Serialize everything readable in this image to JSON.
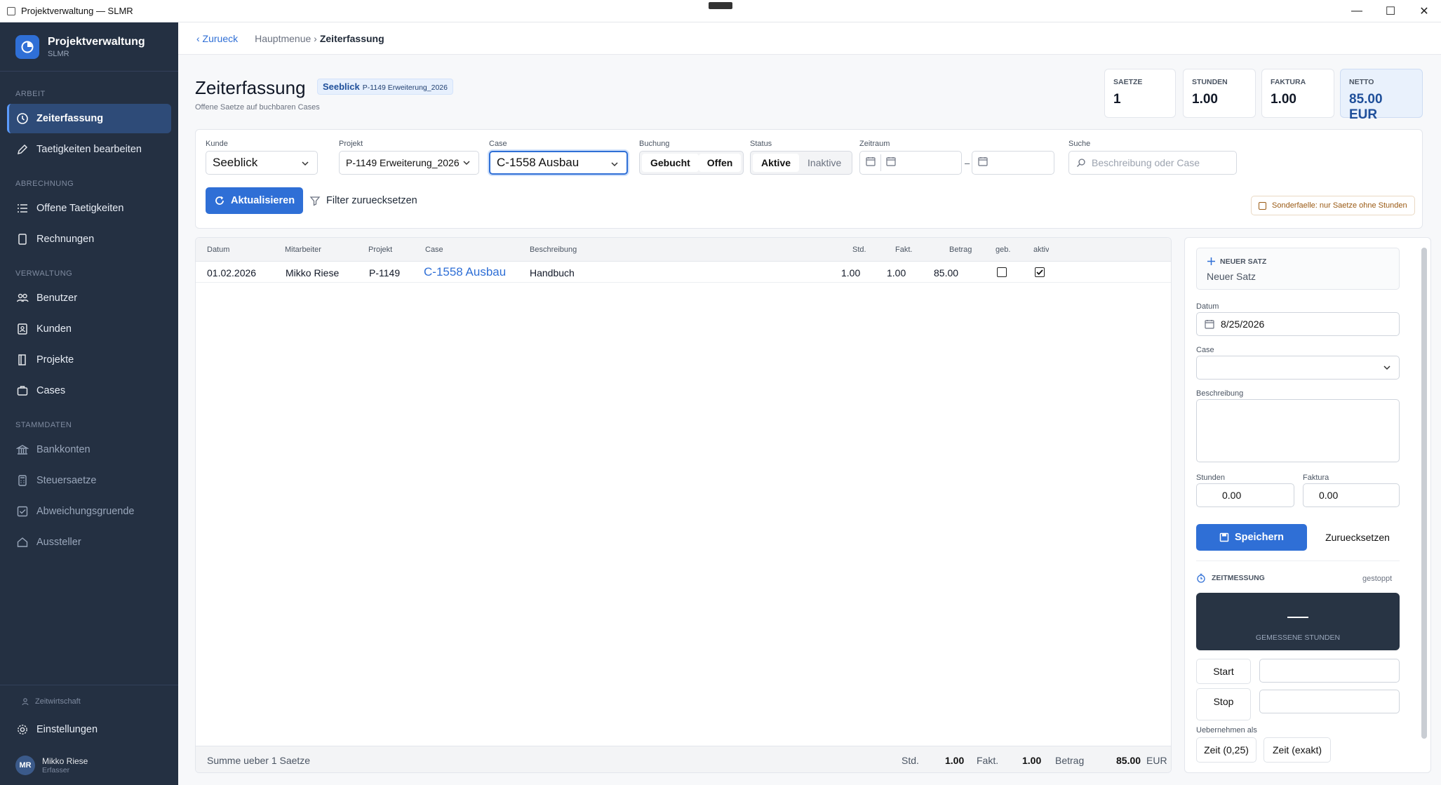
{
  "window": {
    "title": "Projektverwaltung — SLMR",
    "minimize": "—",
    "maximize": "☐",
    "close": "✕"
  },
  "sidebar": {
    "brand_title": "Projektverwaltung",
    "brand_sub": "SLMR",
    "sections": [
      {
        "title": "ARBEIT",
        "items": [
          {
            "label": "Zeiterfassung",
            "icon": "clock-icon"
          },
          {
            "label": "Taetigkeiten bearbeiten",
            "icon": "pencil-icon"
          }
        ]
      },
      {
        "title": "ABRECHNUNG",
        "items": [
          {
            "label": "Offene Taetigkeiten",
            "icon": "list-icon"
          },
          {
            "label": "Rechnungen",
            "icon": "document-icon"
          }
        ]
      },
      {
        "title": "VERWALTUNG",
        "items": [
          {
            "label": "Benutzer",
            "icon": "users-icon"
          },
          {
            "label": "Kunden",
            "icon": "contact-icon"
          },
          {
            "label": "Projekte",
            "icon": "project-icon"
          },
          {
            "label": "Cases",
            "icon": "briefcase-icon"
          }
        ]
      },
      {
        "title": "STAMMDATEN",
        "items": [
          {
            "label": "Bankkonten",
            "icon": "bank-icon"
          },
          {
            "label": "Steuersaetze",
            "icon": "calculator-icon"
          },
          {
            "label": "Abweichungsgruende",
            "icon": "checkbox-icon"
          },
          {
            "label": "Aussteller",
            "icon": "home-icon"
          }
        ]
      }
    ],
    "footer_small": "Zeitwirtschaft",
    "settings_label": "Einstellungen",
    "user_initials": "MR",
    "user_name": "Mikko Riese",
    "user_role": "Erfasser"
  },
  "topbar": {
    "back": "‹ Zurueck",
    "crumb_parent": "Hauptmenue ›",
    "crumb_current": "Zeiterfassung"
  },
  "header": {
    "title": "Zeiterfassung",
    "badge_customer": "Seeblick",
    "badge_project": "P-1149 Erweiterung_2026",
    "subtitle": "Offene Saetze auf buchbaren Cases"
  },
  "kpis": [
    {
      "label": "SAETZE",
      "value": "1"
    },
    {
      "label": "STUNDEN",
      "value": "1.00"
    },
    {
      "label": "FAKTURA",
      "value": "1.00"
    },
    {
      "label": "NETTO",
      "value": "85.00 EUR"
    }
  ],
  "filters": {
    "kunde_label": "Kunde",
    "kunde_value": "Seeblick",
    "projekt_label": "Projekt",
    "projekt_value": "P-1149 Erweiterung_2026",
    "case_label": "Case",
    "case_value": "C-1558 Ausbau",
    "buchung_label": "Buchung",
    "buchung_options": [
      "Gebucht",
      "Offen"
    ],
    "status_label": "Status",
    "status_options": [
      "Aktive",
      "Inaktive"
    ],
    "zeitraum_label": "Zeitraum",
    "zeitraum_sep": "–",
    "suche_label": "Suche",
    "suche_placeholder": "Beschreibung oder Case",
    "refresh_label": "Aktualisieren",
    "reset_label": "Filter zuruecksetzen",
    "special_label": "Sonderfaelle: nur Saetze ohne Stunden"
  },
  "table": {
    "columns": [
      "Datum",
      "Mitarbeiter",
      "Projekt",
      "Case",
      "Beschreibung",
      "Std.",
      "Fakt.",
      "Betrag",
      "geb.",
      "aktiv"
    ],
    "rows": [
      {
        "datum": "01.02.2026",
        "mitarbeiter": "Mikko Riese",
        "projekt": "P-1149",
        "case": "C-1558 Ausbau",
        "beschreibung": "Handbuch",
        "std": "1.00",
        "fakt": "1.00",
        "betrag": "85.00",
        "gebucht": false,
        "aktiv": true
      }
    ],
    "footer": {
      "summary": "Summe ueber 1 Saetze",
      "std_label": "Std.",
      "std_value": "1.00",
      "fakt_label": "Fakt.",
      "fakt_value": "1.00",
      "betrag_label": "Betrag",
      "betrag_value": "85.00",
      "currency": "EUR"
    }
  },
  "panel": {
    "new_label": "NEUER SATZ",
    "new_title": "Neuer Satz",
    "datum_label": "Datum",
    "datum_value": "8/25/2026",
    "case_label": "Case",
    "case_value": "",
    "beschreibung_label": "Beschreibung",
    "stunden_label": "Stunden",
    "stunden_value": "0.00",
    "faktura_label": "Faktura",
    "faktura_value": "0.00",
    "save_label": "Speichern",
    "reset_label": "Zuruecksetzen",
    "timer_label": "ZEITMESSUNG",
    "timer_status": "gestoppt",
    "timer_caption": "GEMESSENE STUNDEN",
    "start_label": "Start",
    "stop_label": "Stop",
    "apply_label": "Uebernehmen als",
    "apply_options": [
      "Zeit (0,25)",
      "Zeit (exakt)"
    ]
  }
}
